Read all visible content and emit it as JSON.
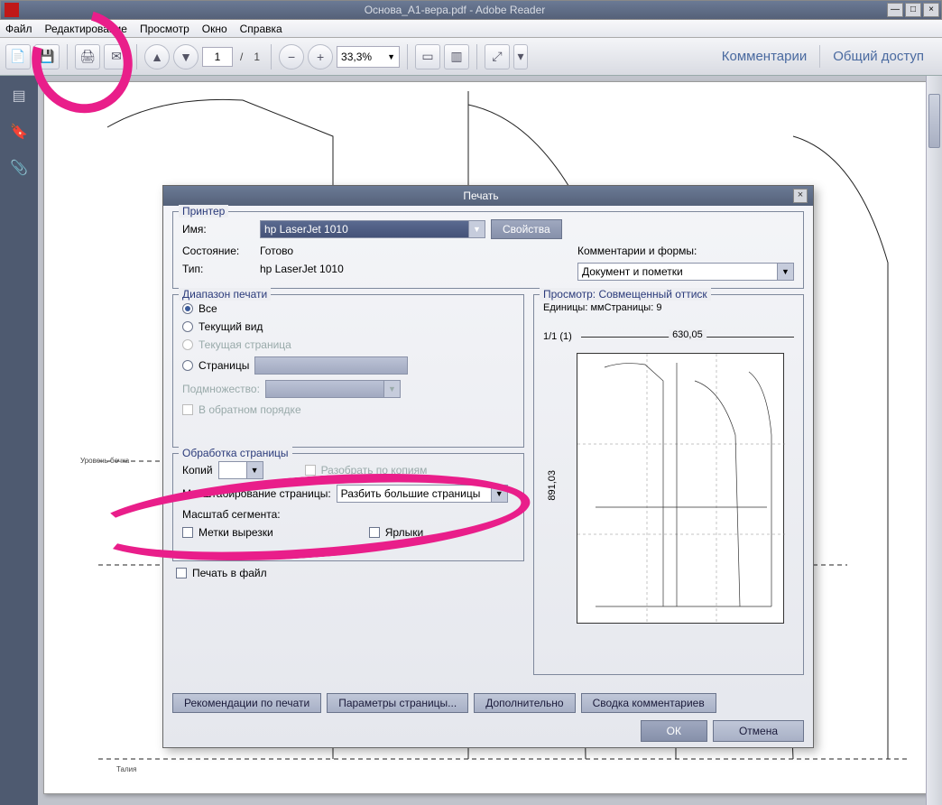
{
  "app": {
    "title": "Основа_А1-вера.pdf - Adobe Reader"
  },
  "menu": {
    "file": "Файл",
    "edit": "Редактирование",
    "view": "Просмотр",
    "window": "Окно",
    "help": "Справка"
  },
  "toolbar": {
    "page_current": "1",
    "page_sep": "/",
    "page_total": "1",
    "zoom": "33,3%",
    "comments": "Комментарии",
    "share": "Общий доступ"
  },
  "doc_labels": {
    "level_side": "Уровень бочка",
    "waist": "Талия"
  },
  "dialog": {
    "title": "Печать",
    "printer": {
      "legend": "Принтер",
      "name_lbl": "Имя:",
      "name_val": "hp LaserJet 1010",
      "properties": "Свойства",
      "status_lbl": "Состояние:",
      "status_val": "Готово",
      "type_lbl": "Тип:",
      "type_val": "hp LaserJet 1010",
      "comm_lbl": "Комментарии и формы:",
      "comm_val": "Документ и пометки"
    },
    "range": {
      "legend": "Диапазон печати",
      "all": "Все",
      "current_view": "Текущий вид",
      "current_page": "Текущая страница",
      "pages": "Страницы",
      "subset": "Подмножество:",
      "reverse": "В обратном порядке"
    },
    "handling": {
      "legend": "Обработка страницы",
      "copies": "Копий",
      "collate": "Разобрать по копиям",
      "scale_lbl": "Масштабирование страницы:",
      "scale_val": "Разбить большие страницы",
      "tile_scale": "Масштаб сегмента:",
      "crop_marks": "Метки вырезки",
      "labels": "Ярлыки"
    },
    "print_to_file": "Печать в файл",
    "preview": {
      "legend": "Просмотр: Совмещенный оттиск",
      "units": "Единицы: ммСтраницы: 9",
      "sheet": "1/1 (1)",
      "width": "630,05",
      "height": "891,03"
    },
    "buttons": {
      "tips": "Рекомендации по печати",
      "page_setup": "Параметры страницы...",
      "advanced": "Дополнительно",
      "summarize": "Сводка комментариев",
      "ok": "ОК",
      "cancel": "Отмена"
    }
  }
}
